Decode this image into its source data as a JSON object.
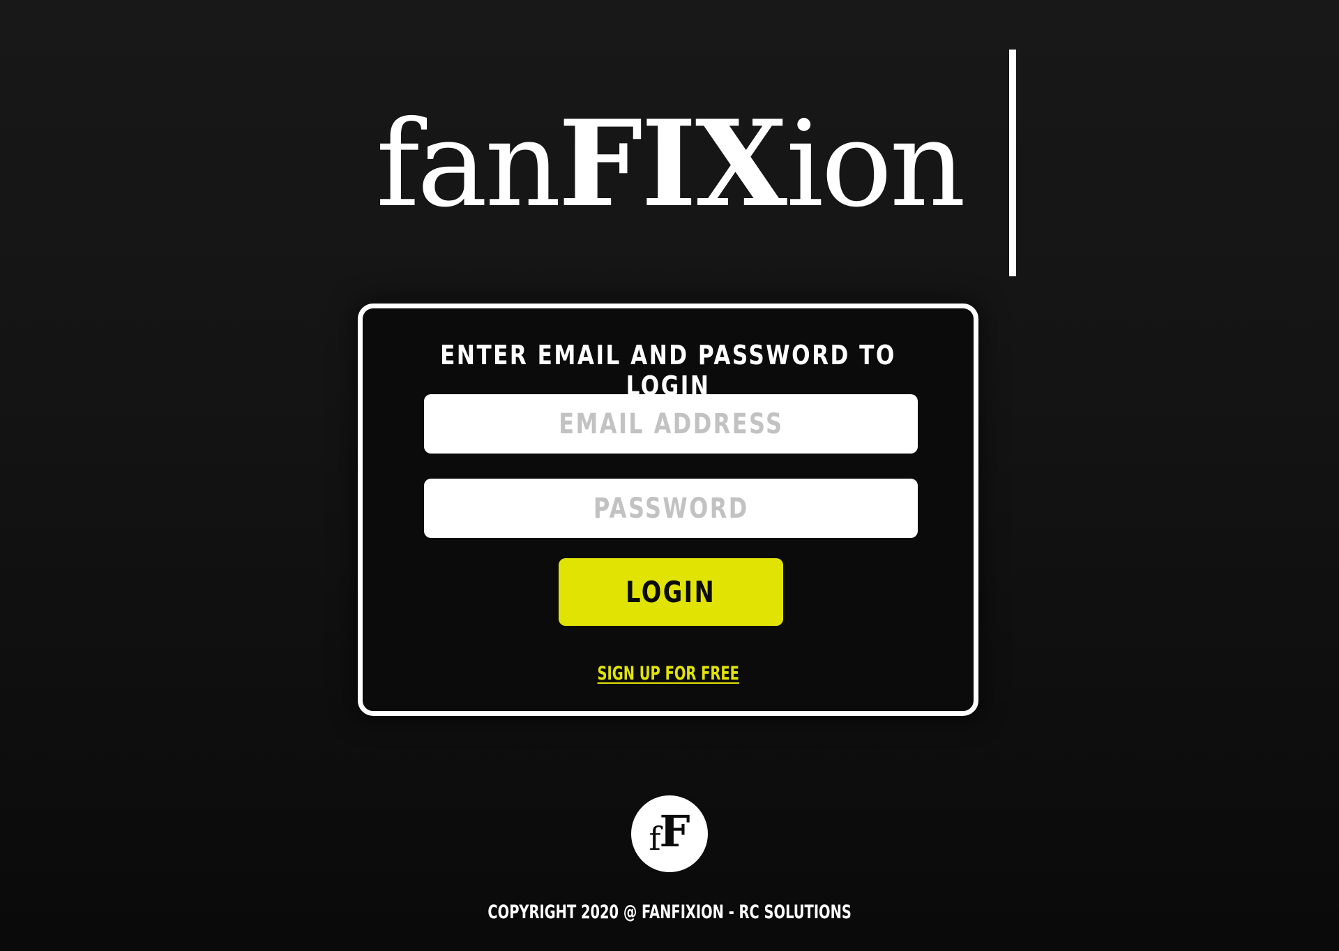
{
  "brand": {
    "logo_part1": "fan",
    "logo_part2": "FIX",
    "logo_part3": "ion",
    "badge_small": "f",
    "badge_large": "F"
  },
  "login_form": {
    "title": "ENTER EMAIL AND PASSWORD TO LOGIN",
    "email_placeholder": "EMAIL ADDRESS",
    "email_value": "",
    "password_placeholder": "PASSWORD",
    "password_value": "",
    "login_label": "LOGIN",
    "signup_label": "SIGN UP FOR FREE"
  },
  "footer": {
    "copyright": "COPYRIGHT 2020 @ FANFIXION - RC SOLUTIONS"
  },
  "colors": {
    "accent": "#e1e303",
    "background": "#141414",
    "card_border": "#ffffff",
    "placeholder": "#c2c2c2"
  }
}
